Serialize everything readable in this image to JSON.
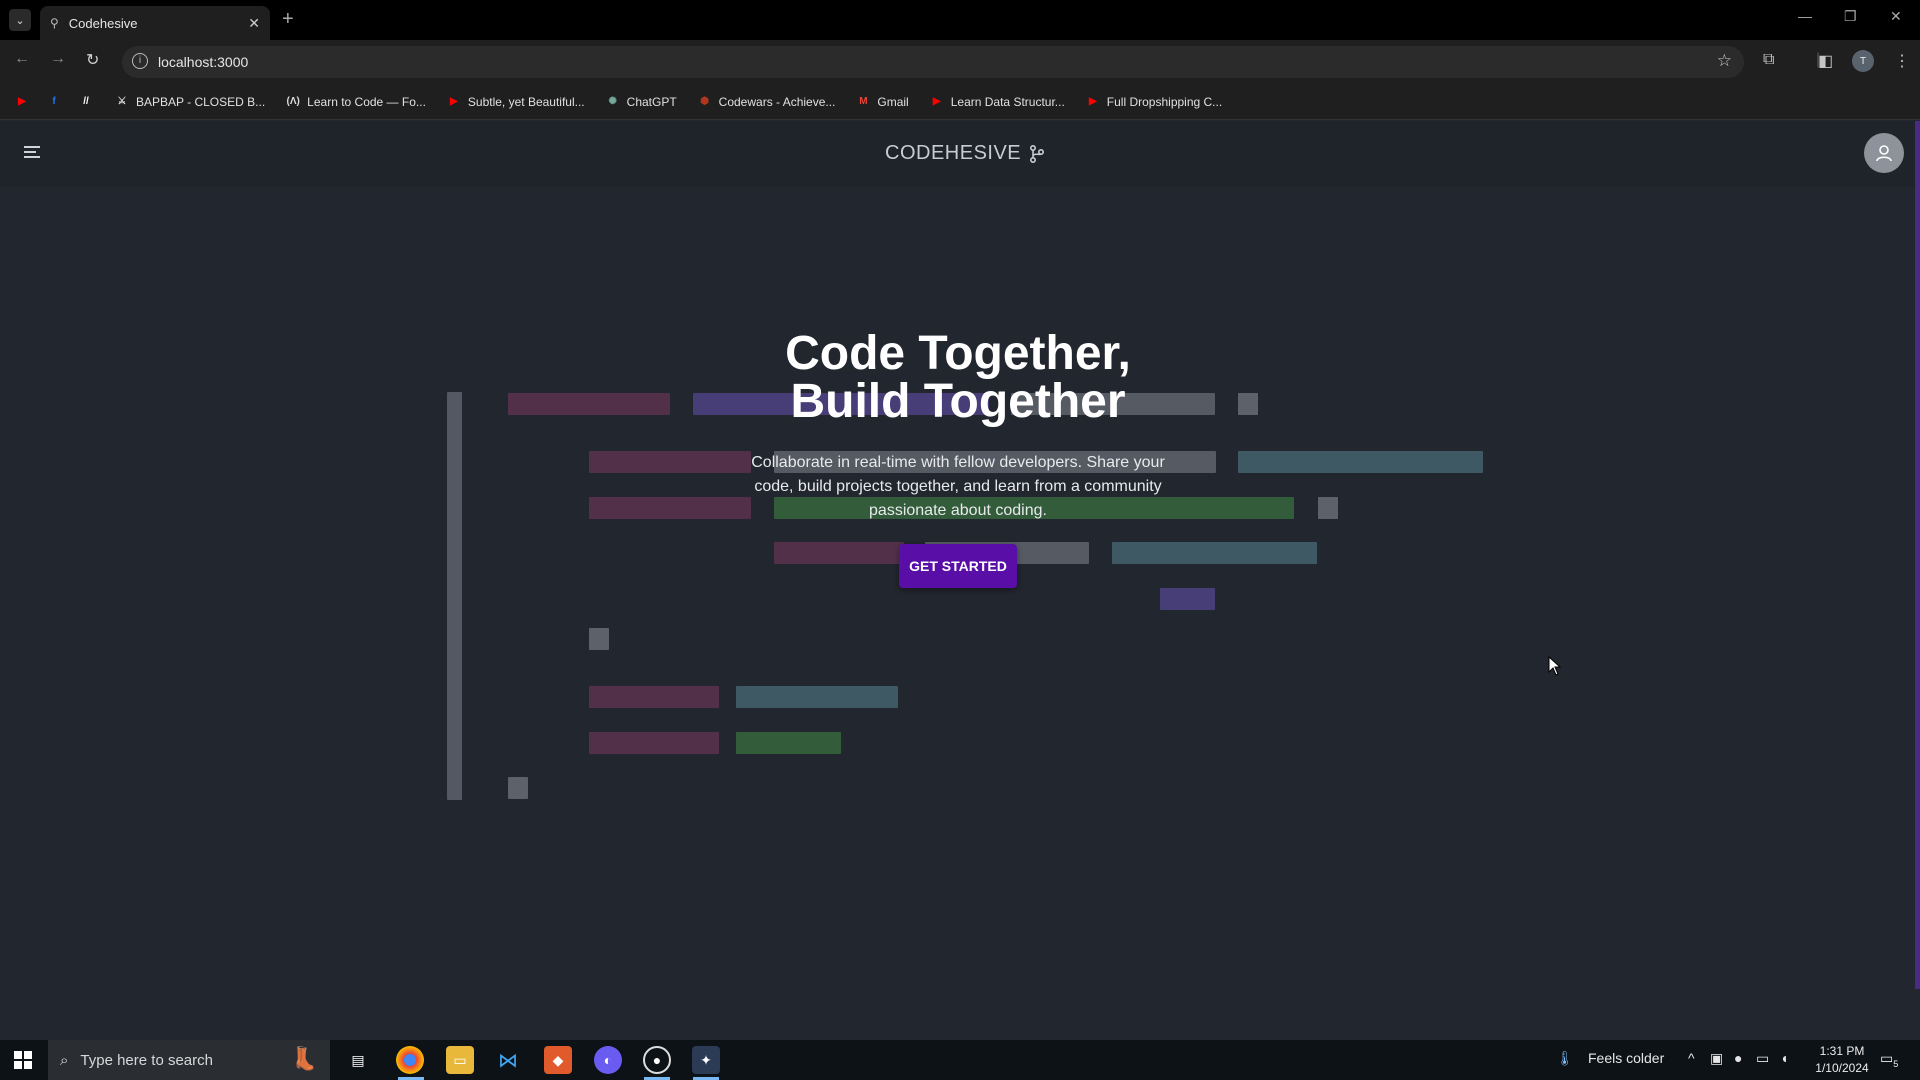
{
  "browser": {
    "tab_title": "Codehesive",
    "url": "localhost:3000",
    "profile_initial": "T",
    "bookmarks": [
      {
        "label": "",
        "icon": "youtube-icon",
        "color": "#ff0000"
      },
      {
        "label": "",
        "icon": "facebook-icon",
        "color": "#1877f2"
      },
      {
        "label": "",
        "icon": "slash-icon",
        "color": "#ffffff"
      },
      {
        "label": "BAPBAP - CLOSED B...",
        "icon": "game-icon",
        "color": "#dddddd"
      },
      {
        "label": "Learn to Code — Fo...",
        "icon": "freecodecamp-icon",
        "color": "#dddddd"
      },
      {
        "label": "Subtle, yet Beautiful...",
        "icon": "youtube-icon",
        "color": "#ff0000"
      },
      {
        "label": "ChatGPT",
        "icon": "chatgpt-icon",
        "color": "#74aa9c"
      },
      {
        "label": "Codewars - Achieve...",
        "icon": "codewars-icon",
        "color": "#b1361e"
      },
      {
        "label": "Gmail",
        "icon": "gmail-icon",
        "color": "#ea4335"
      },
      {
        "label": "Learn Data Structur...",
        "icon": "youtube-icon",
        "color": "#ff0000"
      },
      {
        "label": "Full Dropshipping C...",
        "icon": "youtube-icon",
        "color": "#ff0000"
      }
    ]
  },
  "app": {
    "brand": "CODEHESIVE",
    "hero": {
      "title_line1": "Code Together,",
      "title_line2": "Build Together",
      "subtitle": "Collaborate in real-time with fellow developers. Share your code, build projects together, and learn from a community passionate about coding.",
      "cta": "GET STARTED"
    },
    "colors": {
      "accent": "#5a0ea8",
      "background": "#22262e"
    }
  },
  "taskbar": {
    "search_placeholder": "Type here to search",
    "weather": "Feels colder",
    "time": "1:31 PM",
    "date": "1/10/2024",
    "notification_count": "5"
  }
}
